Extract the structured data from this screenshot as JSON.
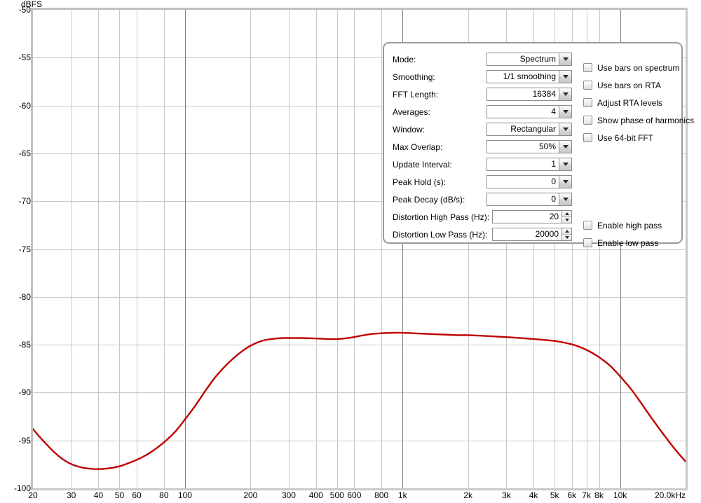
{
  "chart_data": {
    "type": "line",
    "title": "",
    "xlabel": "",
    "ylabel": "dBFS",
    "unit_label": "dBFS",
    "xscale": "log",
    "xlim": [
      20,
      20000
    ],
    "ylim": [
      -100,
      -50
    ],
    "grid": true,
    "legend": "none",
    "line_color": "#c00000",
    "x_tick_labels": [
      "20",
      "30",
      "40",
      "50",
      "60",
      "80",
      "100",
      "200",
      "300",
      "400",
      "500",
      "600",
      "800",
      "1k",
      "2k",
      "3k",
      "4k",
      "5k",
      "6k",
      "7k",
      "8k",
      "10k",
      "20.0kHz"
    ],
    "x_tick_values": [
      20,
      30,
      40,
      50,
      60,
      80,
      100,
      200,
      300,
      400,
      500,
      600,
      800,
      1000,
      2000,
      3000,
      4000,
      5000,
      6000,
      7000,
      8000,
      10000,
      20000
    ],
    "y_tick_labels": [
      "-50",
      "-55",
      "-60",
      "-65",
      "-70",
      "-75",
      "-80",
      "-85",
      "-90",
      "-95",
      "-100"
    ],
    "y_tick_values": [
      -50,
      -55,
      -60,
      -65,
      -70,
      -75,
      -80,
      -85,
      -90,
      -95,
      -100
    ],
    "series": [
      {
        "name": "Spectrum",
        "x": [
          20,
          22,
          25,
          28,
          31,
          35,
          40,
          45,
          50,
          56,
          63,
          71,
          80,
          90,
          100,
          112,
          125,
          140,
          160,
          180,
          200,
          225,
          250,
          280,
          315,
          355,
          400,
          450,
          500,
          560,
          630,
          710,
          800,
          900,
          1000,
          1120,
          1250,
          1400,
          1600,
          1800,
          2000,
          2500,
          3000,
          3500,
          4000,
          4500,
          5000,
          5600,
          6300,
          7100,
          8000,
          9000,
          10000,
          11200,
          12500,
          14000,
          16000,
          18000,
          20000
        ],
        "y": [
          -93.8,
          -94.9,
          -96.2,
          -97.1,
          -97.6,
          -97.9,
          -98.0,
          -97.9,
          -97.7,
          -97.3,
          -96.8,
          -96.1,
          -95.2,
          -94.1,
          -92.8,
          -91.3,
          -89.7,
          -88.2,
          -86.8,
          -85.8,
          -85.1,
          -84.6,
          -84.4,
          -84.3,
          -84.3,
          -84.3,
          -84.35,
          -84.4,
          -84.4,
          -84.3,
          -84.1,
          -83.9,
          -83.8,
          -83.75,
          -83.75,
          -83.8,
          -83.85,
          -83.9,
          -83.95,
          -84.0,
          -84.0,
          -84.1,
          -84.2,
          -84.3,
          -84.4,
          -84.5,
          -84.6,
          -84.8,
          -85.1,
          -85.6,
          -86.3,
          -87.2,
          -88.3,
          -89.6,
          -91.1,
          -92.7,
          -94.5,
          -96.0,
          -97.2
        ]
      }
    ]
  },
  "panel": {
    "fields": [
      {
        "label": "Mode:",
        "value": "Spectrum",
        "control": "combo"
      },
      {
        "label": "Smoothing:",
        "value": "1/1 smoothing",
        "control": "combo"
      },
      {
        "label": "FFT Length:",
        "value": "16384",
        "control": "combo"
      },
      {
        "label": "Averages:",
        "value": "4",
        "control": "combo"
      },
      {
        "label": "Window:",
        "value": "Rectangular",
        "control": "combo"
      },
      {
        "label": "Max Overlap:",
        "value": "50%",
        "control": "combo"
      },
      {
        "label": "Update Interval:",
        "value": "1",
        "control": "combo"
      },
      {
        "label": "Peak Hold (s):",
        "value": "0",
        "control": "combo"
      },
      {
        "label": "Peak Decay (dB/s):",
        "value": "0",
        "control": "combo"
      },
      {
        "label": "Distortion High Pass (Hz):",
        "value": "20",
        "control": "spin"
      },
      {
        "label": "Distortion Low Pass (Hz):",
        "value": "20000",
        "control": "spin"
      }
    ],
    "checkboxes_top": [
      {
        "label": "Use bars on spectrum",
        "checked": false
      },
      {
        "label": "Use bars on RTA",
        "checked": false
      },
      {
        "label": "Adjust RTA levels",
        "checked": false
      },
      {
        "label": "Show phase of harmonics",
        "checked": false
      },
      {
        "label": "Use 64-bit FFT",
        "checked": false
      }
    ],
    "checkboxes_bottom": [
      {
        "label": "Enable high pass",
        "checked": false
      },
      {
        "label": "Enable low pass",
        "checked": false
      }
    ]
  },
  "colors": {
    "curve": "#c00000",
    "grid_minor": "#c8c8c8",
    "grid_major": "#808080",
    "frame": "#c0c0c0"
  }
}
